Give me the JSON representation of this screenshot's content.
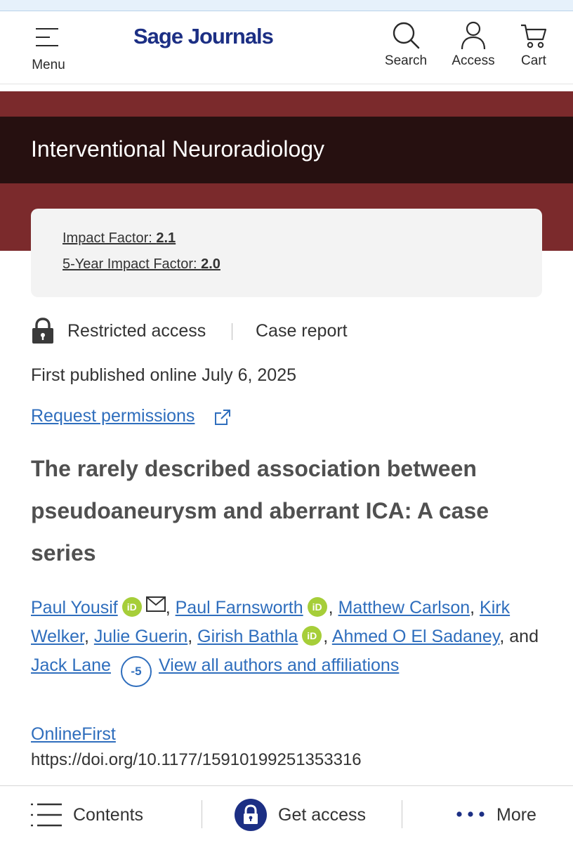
{
  "header": {
    "menu_label": "Menu",
    "logo_text": "Sage Journals",
    "search_label": "Search",
    "access_label": "Access",
    "cart_label": "Cart"
  },
  "journal": {
    "title": "Interventional Neuroradiology",
    "impact_factor_label": "Impact Factor: ",
    "impact_factor_value": "2.1",
    "five_year_label": "5-Year Impact Factor: ",
    "five_year_value": "2.0"
  },
  "article": {
    "access_type": "Restricted access",
    "article_type": "Case report",
    "published": "First published online July 6, 2025",
    "permissions_link": "Request permissions",
    "title": "The rarely described association between pseudoaneurysm and aberrant ICA: A case series",
    "authors": [
      "Paul Yousif",
      "Paul Farnsworth",
      "Matthew Carlson",
      "Kirk Welker",
      "Julie Guerin",
      "Girish Bathla",
      "Ahmed O El Sadaney",
      "Jack Lane"
    ],
    "orcid_label": "iD",
    "and_text": ", and ",
    "collapse_badge": "-5",
    "view_all": "View all authors and affiliations",
    "status": "OnlineFirst",
    "doi": "https://doi.org/10.1177/15910199251353316"
  },
  "bottom_bar": {
    "contents": "Contents",
    "get_access": "Get access",
    "more": "More"
  },
  "colors": {
    "brand_navy": "#1c2f84",
    "maroon": "#7b2a2c",
    "dark_band": "#261010",
    "link": "#2f6ebd",
    "orcid": "#a6ce39"
  },
  "icons": [
    "menu-icon",
    "search-icon",
    "user-icon",
    "cart-icon",
    "lock-icon",
    "external-link-icon",
    "orcid-icon",
    "mail-icon",
    "list-icon",
    "ellipsis-icon"
  ]
}
